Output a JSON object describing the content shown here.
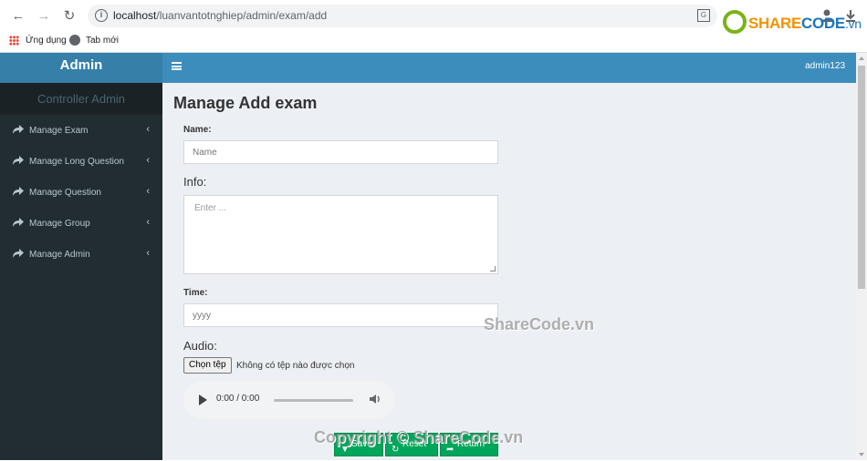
{
  "browser": {
    "url_host": "localhost",
    "url_path": "/luanvantotnghiep/admin/exam/add",
    "bookmarks": [
      "Ứng dụng",
      "Tab mới"
    ]
  },
  "logo": {
    "share": "SHARE",
    "code": "CODE",
    "vn": ".vn"
  },
  "sidebar": {
    "brand": "Admin",
    "header": "Controller Admin",
    "items": [
      {
        "label": "Manage Exam"
      },
      {
        "label": "Manage Long Question"
      },
      {
        "label": "Manage Question"
      },
      {
        "label": "Manage Group"
      },
      {
        "label": "Manage Admin"
      }
    ]
  },
  "topbar": {
    "user": "admin123"
  },
  "form": {
    "title": "Manage Add exam",
    "name_label": "Name:",
    "name_placeholder": "Name",
    "info_label": "Info:",
    "info_placeholder": "Enter ...",
    "time_label": "Time:",
    "time_placeholder": "yyyy",
    "audio_label": "Audio:",
    "file_button": "Chọn tệp",
    "file_status": "Không có tệp nào được chọn",
    "audio_time": "0:00 / 0:00",
    "save_label": "Save",
    "reset_label": "Reset",
    "return_label": "Return"
  },
  "watermarks": {
    "middle": "ShareCode.vn",
    "bottom": "Copyright © ShareCode.vn"
  },
  "colors": {
    "sidebar_bg": "#222d32",
    "topbar_bg": "#3c8dbc",
    "brand_bg": "#367fa9",
    "button_green": "#00a65a",
    "content_bg": "#ecf0f5"
  }
}
